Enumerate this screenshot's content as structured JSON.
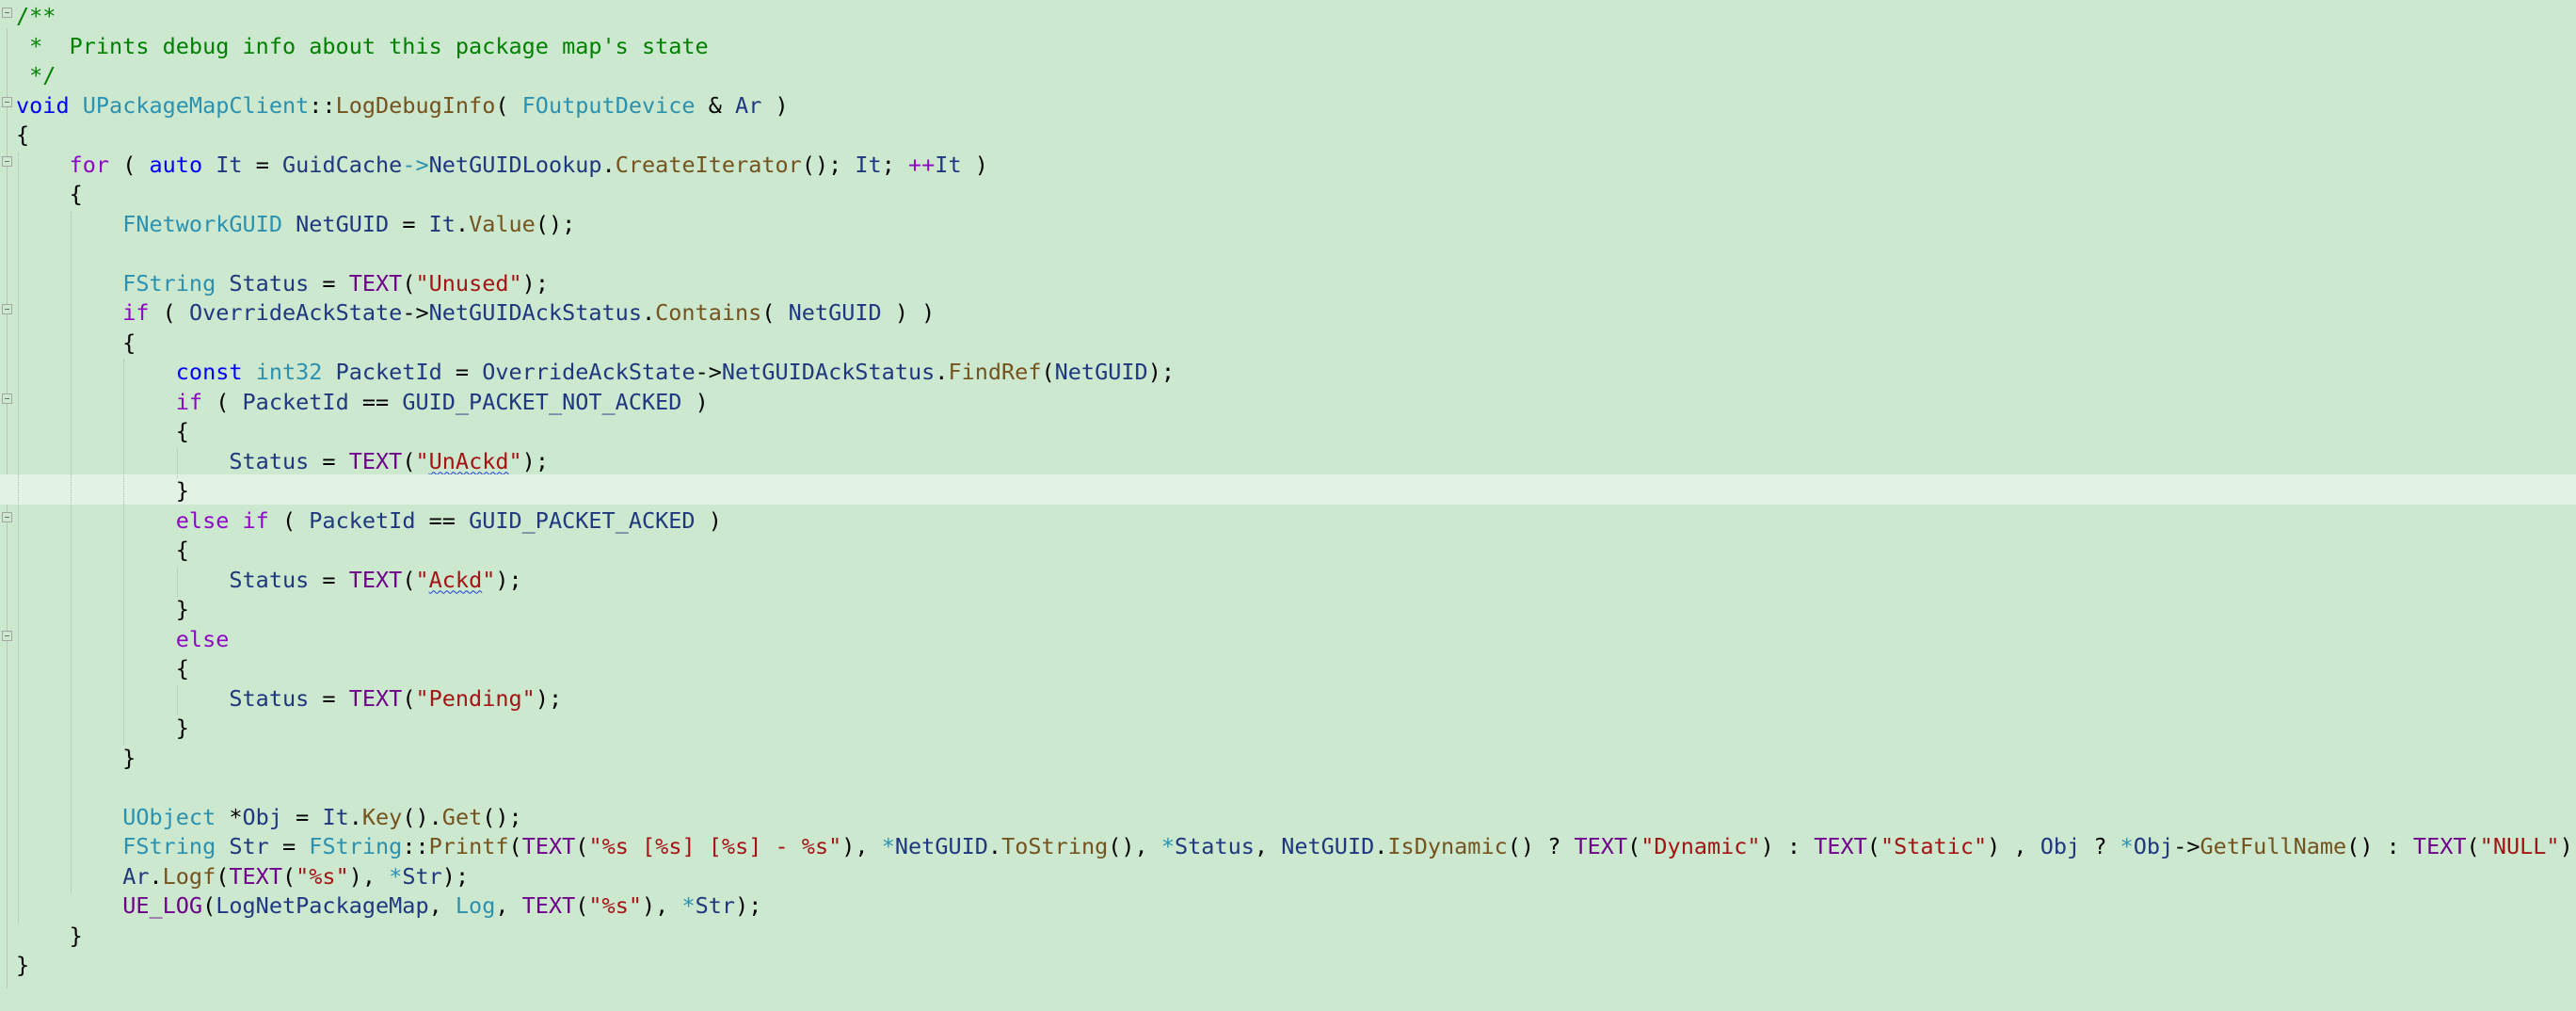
{
  "editor": {
    "background": "#cce8cf",
    "current_line_index": 16,
    "colors": {
      "text": "#000000",
      "keyword": "#0000ff",
      "control": "#8f08c4",
      "type": "#2b91af",
      "function": "#74531f",
      "string": "#a31515",
      "comment": "#008000",
      "identifier": "#1f377f",
      "macro": "#6f008a"
    },
    "lines": [
      {
        "fold": true,
        "tokens": [
          {
            "t": "/**",
            "c": "comment"
          }
        ]
      },
      {
        "fold": false,
        "tokens": [
          {
            "t": " *  Prints debug info about this package map's state",
            "c": "comment"
          }
        ]
      },
      {
        "fold": false,
        "tokens": [
          {
            "t": " */",
            "c": "comment"
          }
        ]
      },
      {
        "fold": true,
        "tokens": [
          {
            "t": "void",
            "c": "keyword"
          },
          {
            "t": " "
          },
          {
            "t": "UPackageMapClient",
            "c": "type"
          },
          {
            "t": "::"
          },
          {
            "t": "LogDebugInfo",
            "c": "function"
          },
          {
            "t": "( "
          },
          {
            "t": "FOutputDevice",
            "c": "type"
          },
          {
            "t": " & "
          },
          {
            "t": "Ar",
            "c": "identifier"
          },
          {
            "t": " )"
          }
        ]
      },
      {
        "fold": false,
        "tokens": [
          {
            "t": "{"
          }
        ]
      },
      {
        "fold": true,
        "tokens": [
          {
            "t": "    "
          },
          {
            "t": "for",
            "c": "control"
          },
          {
            "t": " ( "
          },
          {
            "t": "auto",
            "c": "keyword"
          },
          {
            "t": " "
          },
          {
            "t": "It",
            "c": "identifier"
          },
          {
            "t": " = "
          },
          {
            "t": "GuidCache",
            "c": "identifier"
          },
          {
            "t": "->",
            "c": "type"
          },
          {
            "t": "NetGUIDLookup",
            "c": "identifier"
          },
          {
            "t": "."
          },
          {
            "t": "CreateIterator",
            "c": "function"
          },
          {
            "t": "(); "
          },
          {
            "t": "It",
            "c": "identifier"
          },
          {
            "t": "; "
          },
          {
            "t": "++",
            "c": "control"
          },
          {
            "t": "It",
            "c": "identifier"
          },
          {
            "t": " )"
          }
        ]
      },
      {
        "fold": false,
        "tokens": [
          {
            "t": "    {"
          }
        ]
      },
      {
        "fold": false,
        "tokens": [
          {
            "t": "        "
          },
          {
            "t": "FNetworkGUID",
            "c": "type"
          },
          {
            "t": " "
          },
          {
            "t": "NetGUID",
            "c": "identifier"
          },
          {
            "t": " = "
          },
          {
            "t": "It",
            "c": "identifier"
          },
          {
            "t": "."
          },
          {
            "t": "Value",
            "c": "function"
          },
          {
            "t": "();"
          }
        ]
      },
      {
        "fold": false,
        "tokens": [
          {
            "t": ""
          }
        ]
      },
      {
        "fold": false,
        "tokens": [
          {
            "t": "        "
          },
          {
            "t": "FString",
            "c": "type"
          },
          {
            "t": " "
          },
          {
            "t": "Status",
            "c": "identifier"
          },
          {
            "t": " = "
          },
          {
            "t": "TEXT",
            "c": "macro"
          },
          {
            "t": "("
          },
          {
            "t": "\"Unused\"",
            "c": "string"
          },
          {
            "t": ");"
          }
        ]
      },
      {
        "fold": true,
        "tokens": [
          {
            "t": "        "
          },
          {
            "t": "if",
            "c": "control"
          },
          {
            "t": " ( "
          },
          {
            "t": "OverrideAckState",
            "c": "identifier"
          },
          {
            "t": "->"
          },
          {
            "t": "NetGUIDAckStatus",
            "c": "identifier"
          },
          {
            "t": "."
          },
          {
            "t": "Contains",
            "c": "function"
          },
          {
            "t": "( "
          },
          {
            "t": "NetGUID",
            "c": "identifier"
          },
          {
            "t": " ) )"
          }
        ]
      },
      {
        "fold": false,
        "tokens": [
          {
            "t": "        {"
          }
        ]
      },
      {
        "fold": false,
        "tokens": [
          {
            "t": "            "
          },
          {
            "t": "const",
            "c": "keyword"
          },
          {
            "t": " "
          },
          {
            "t": "int32",
            "c": "type"
          },
          {
            "t": " "
          },
          {
            "t": "PacketId",
            "c": "identifier"
          },
          {
            "t": " = "
          },
          {
            "t": "OverrideAckState",
            "c": "identifier"
          },
          {
            "t": "->"
          },
          {
            "t": "NetGUIDAckStatus",
            "c": "identifier"
          },
          {
            "t": "."
          },
          {
            "t": "FindRef",
            "c": "function"
          },
          {
            "t": "("
          },
          {
            "t": "NetGUID",
            "c": "identifier"
          },
          {
            "t": ");"
          }
        ]
      },
      {
        "fold": true,
        "tokens": [
          {
            "t": "            "
          },
          {
            "t": "if",
            "c": "control"
          },
          {
            "t": " ( "
          },
          {
            "t": "PacketId",
            "c": "identifier"
          },
          {
            "t": " == "
          },
          {
            "t": "GUID_PACKET_NOT_ACKED",
            "c": "identifier"
          },
          {
            "t": " )"
          }
        ]
      },
      {
        "fold": false,
        "tokens": [
          {
            "t": "            {"
          }
        ]
      },
      {
        "fold": false,
        "tokens": [
          {
            "t": "                "
          },
          {
            "t": "Status",
            "c": "identifier"
          },
          {
            "t": " = "
          },
          {
            "t": "TEXT",
            "c": "macro"
          },
          {
            "t": "("
          },
          {
            "t": "\"",
            "c": "string"
          },
          {
            "t": "UnAckd",
            "c": "string",
            "squiggle": true
          },
          {
            "t": "\"",
            "c": "string"
          },
          {
            "t": ");"
          }
        ]
      },
      {
        "fold": false,
        "tokens": [
          {
            "t": "            }"
          }
        ]
      },
      {
        "fold": true,
        "tokens": [
          {
            "t": "            "
          },
          {
            "t": "else",
            "c": "control"
          },
          {
            "t": " "
          },
          {
            "t": "if",
            "c": "control"
          },
          {
            "t": " ( "
          },
          {
            "t": "PacketId",
            "c": "identifier"
          },
          {
            "t": " == "
          },
          {
            "t": "GUID_PACKET_ACKED",
            "c": "identifier"
          },
          {
            "t": " )"
          }
        ]
      },
      {
        "fold": false,
        "tokens": [
          {
            "t": "            {"
          }
        ]
      },
      {
        "fold": false,
        "tokens": [
          {
            "t": "                "
          },
          {
            "t": "Status",
            "c": "identifier"
          },
          {
            "t": " = "
          },
          {
            "t": "TEXT",
            "c": "macro"
          },
          {
            "t": "("
          },
          {
            "t": "\"",
            "c": "string"
          },
          {
            "t": "Ackd",
            "c": "string",
            "squiggle": true
          },
          {
            "t": "\"",
            "c": "string"
          },
          {
            "t": ");"
          }
        ]
      },
      {
        "fold": false,
        "tokens": [
          {
            "t": "            }"
          }
        ]
      },
      {
        "fold": true,
        "tokens": [
          {
            "t": "            "
          },
          {
            "t": "else",
            "c": "control"
          }
        ]
      },
      {
        "fold": false,
        "tokens": [
          {
            "t": "            {"
          }
        ]
      },
      {
        "fold": false,
        "tokens": [
          {
            "t": "                "
          },
          {
            "t": "Status",
            "c": "identifier"
          },
          {
            "t": " = "
          },
          {
            "t": "TEXT",
            "c": "macro"
          },
          {
            "t": "("
          },
          {
            "t": "\"Pending\"",
            "c": "string"
          },
          {
            "t": ");"
          }
        ]
      },
      {
        "fold": false,
        "tokens": [
          {
            "t": "            }"
          }
        ]
      },
      {
        "fold": false,
        "tokens": [
          {
            "t": "        }"
          }
        ]
      },
      {
        "fold": false,
        "tokens": [
          {
            "t": ""
          }
        ]
      },
      {
        "fold": false,
        "tokens": [
          {
            "t": "        "
          },
          {
            "t": "UObject",
            "c": "type"
          },
          {
            "t": " *"
          },
          {
            "t": "Obj",
            "c": "identifier"
          },
          {
            "t": " = "
          },
          {
            "t": "It",
            "c": "identifier"
          },
          {
            "t": "."
          },
          {
            "t": "Key",
            "c": "function"
          },
          {
            "t": "()."
          },
          {
            "t": "Get",
            "c": "function"
          },
          {
            "t": "();"
          }
        ]
      },
      {
        "fold": false,
        "tokens": [
          {
            "t": "        "
          },
          {
            "t": "FString",
            "c": "type"
          },
          {
            "t": " "
          },
          {
            "t": "Str",
            "c": "identifier"
          },
          {
            "t": " = "
          },
          {
            "t": "FString",
            "c": "type"
          },
          {
            "t": "::"
          },
          {
            "t": "Printf",
            "c": "function"
          },
          {
            "t": "("
          },
          {
            "t": "TEXT",
            "c": "macro"
          },
          {
            "t": "("
          },
          {
            "t": "\"%s [%s] [%s] - %s\"",
            "c": "string"
          },
          {
            "t": "), "
          },
          {
            "t": "*",
            "c": "type"
          },
          {
            "t": "NetGUID",
            "c": "identifier"
          },
          {
            "t": "."
          },
          {
            "t": "ToString",
            "c": "function"
          },
          {
            "t": "(), "
          },
          {
            "t": "*",
            "c": "type"
          },
          {
            "t": "Status",
            "c": "identifier"
          },
          {
            "t": ", "
          },
          {
            "t": "NetGUID",
            "c": "identifier"
          },
          {
            "t": "."
          },
          {
            "t": "IsDynamic",
            "c": "function"
          },
          {
            "t": "() ? "
          },
          {
            "t": "TEXT",
            "c": "macro"
          },
          {
            "t": "("
          },
          {
            "t": "\"Dynamic\"",
            "c": "string"
          },
          {
            "t": ") : "
          },
          {
            "t": "TEXT",
            "c": "macro"
          },
          {
            "t": "("
          },
          {
            "t": "\"Static\"",
            "c": "string"
          },
          {
            "t": ") , "
          },
          {
            "t": "Obj",
            "c": "identifier"
          },
          {
            "t": " ? "
          },
          {
            "t": "*",
            "c": "type"
          },
          {
            "t": "Obj",
            "c": "identifier"
          },
          {
            "t": "->"
          },
          {
            "t": "GetFullName",
            "c": "function"
          },
          {
            "t": "() : "
          },
          {
            "t": "TEXT",
            "c": "macro"
          },
          {
            "t": "("
          },
          {
            "t": "\"NULL\"",
            "c": "string"
          },
          {
            "t": "));"
          }
        ]
      },
      {
        "fold": false,
        "tokens": [
          {
            "t": "        "
          },
          {
            "t": "Ar",
            "c": "identifier"
          },
          {
            "t": "."
          },
          {
            "t": "Logf",
            "c": "function"
          },
          {
            "t": "("
          },
          {
            "t": "TEXT",
            "c": "macro"
          },
          {
            "t": "("
          },
          {
            "t": "\"%s\"",
            "c": "string"
          },
          {
            "t": "), "
          },
          {
            "t": "*",
            "c": "type"
          },
          {
            "t": "Str",
            "c": "identifier"
          },
          {
            "t": ");"
          }
        ]
      },
      {
        "fold": false,
        "tokens": [
          {
            "t": "        "
          },
          {
            "t": "UE_LOG",
            "c": "macro"
          },
          {
            "t": "("
          },
          {
            "t": "LogNetPackageMap",
            "c": "identifier"
          },
          {
            "t": ", "
          },
          {
            "t": "Log",
            "c": "type"
          },
          {
            "t": ", "
          },
          {
            "t": "TEXT",
            "c": "macro"
          },
          {
            "t": "("
          },
          {
            "t": "\"%s\"",
            "c": "string"
          },
          {
            "t": "), "
          },
          {
            "t": "*",
            "c": "type"
          },
          {
            "t": "Str",
            "c": "identifier"
          },
          {
            "t": ");"
          }
        ]
      },
      {
        "fold": false,
        "tokens": [
          {
            "t": "    }"
          }
        ]
      },
      {
        "fold": false,
        "tokens": [
          {
            "t": "}"
          }
        ]
      }
    ]
  }
}
